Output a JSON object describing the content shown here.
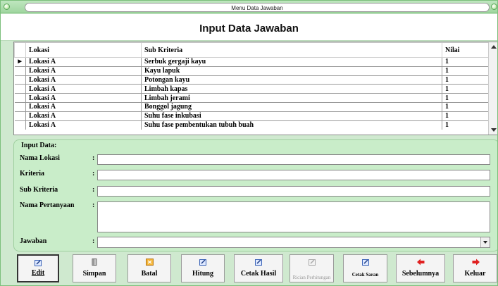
{
  "window": {
    "title": "Menu Data Jawaban"
  },
  "header": {
    "title": "Input Data Jawaban"
  },
  "grid": {
    "columns": [
      "Lokasi",
      "Sub Kriteria",
      "Nilai"
    ],
    "rows": [
      [
        "Lokasi A",
        "Serbuk gergaji kayu",
        "1"
      ],
      [
        "Lokasi A",
        "Kayu lapuk",
        "1"
      ],
      [
        "Lokasi A",
        "Potongan kayu",
        "1"
      ],
      [
        "Lokasi A",
        "Limbah kapas",
        "1"
      ],
      [
        "Lokasi A",
        "Limbah jerami",
        "1"
      ],
      [
        "Lokasi A",
        "Bonggol jagung",
        "1"
      ],
      [
        "Lokasi A",
        "Suhu fase inkubasi",
        "1"
      ],
      [
        "Lokasi A",
        "Suhu fase pembentukan tubuh buah",
        "1"
      ]
    ]
  },
  "form": {
    "legend": "Input Data:",
    "fields": [
      {
        "label": "Nama Lokasi",
        "value": ""
      },
      {
        "label": "Kriteria",
        "value": ""
      },
      {
        "label": "Sub Kriteria",
        "value": ""
      },
      {
        "label": "Nama Pertanyaan",
        "value": ""
      },
      {
        "label": "Jawaban",
        "value": ""
      }
    ],
    "colon": ":"
  },
  "buttons": [
    {
      "label": "Edit",
      "icon": "edit-icon"
    },
    {
      "label": "Simpan",
      "icon": "save-icon"
    },
    {
      "label": "Batal",
      "icon": "cancel-icon"
    },
    {
      "label": "Hitung",
      "icon": "calculate-icon"
    },
    {
      "label": "Cetak Hasil",
      "icon": "print-icon"
    },
    {
      "label": "Rician Perhitungan",
      "icon": "details-icon"
    },
    {
      "label": "Cetak Saran",
      "icon": "print-suggestion-icon"
    },
    {
      "label": "Sebelumnya",
      "icon": "arrow-left-icon"
    },
    {
      "label": "Keluar",
      "icon": "arrow-right-icon"
    }
  ],
  "colors": {
    "accent": "#c9edc9",
    "arrow": "#e02020"
  }
}
